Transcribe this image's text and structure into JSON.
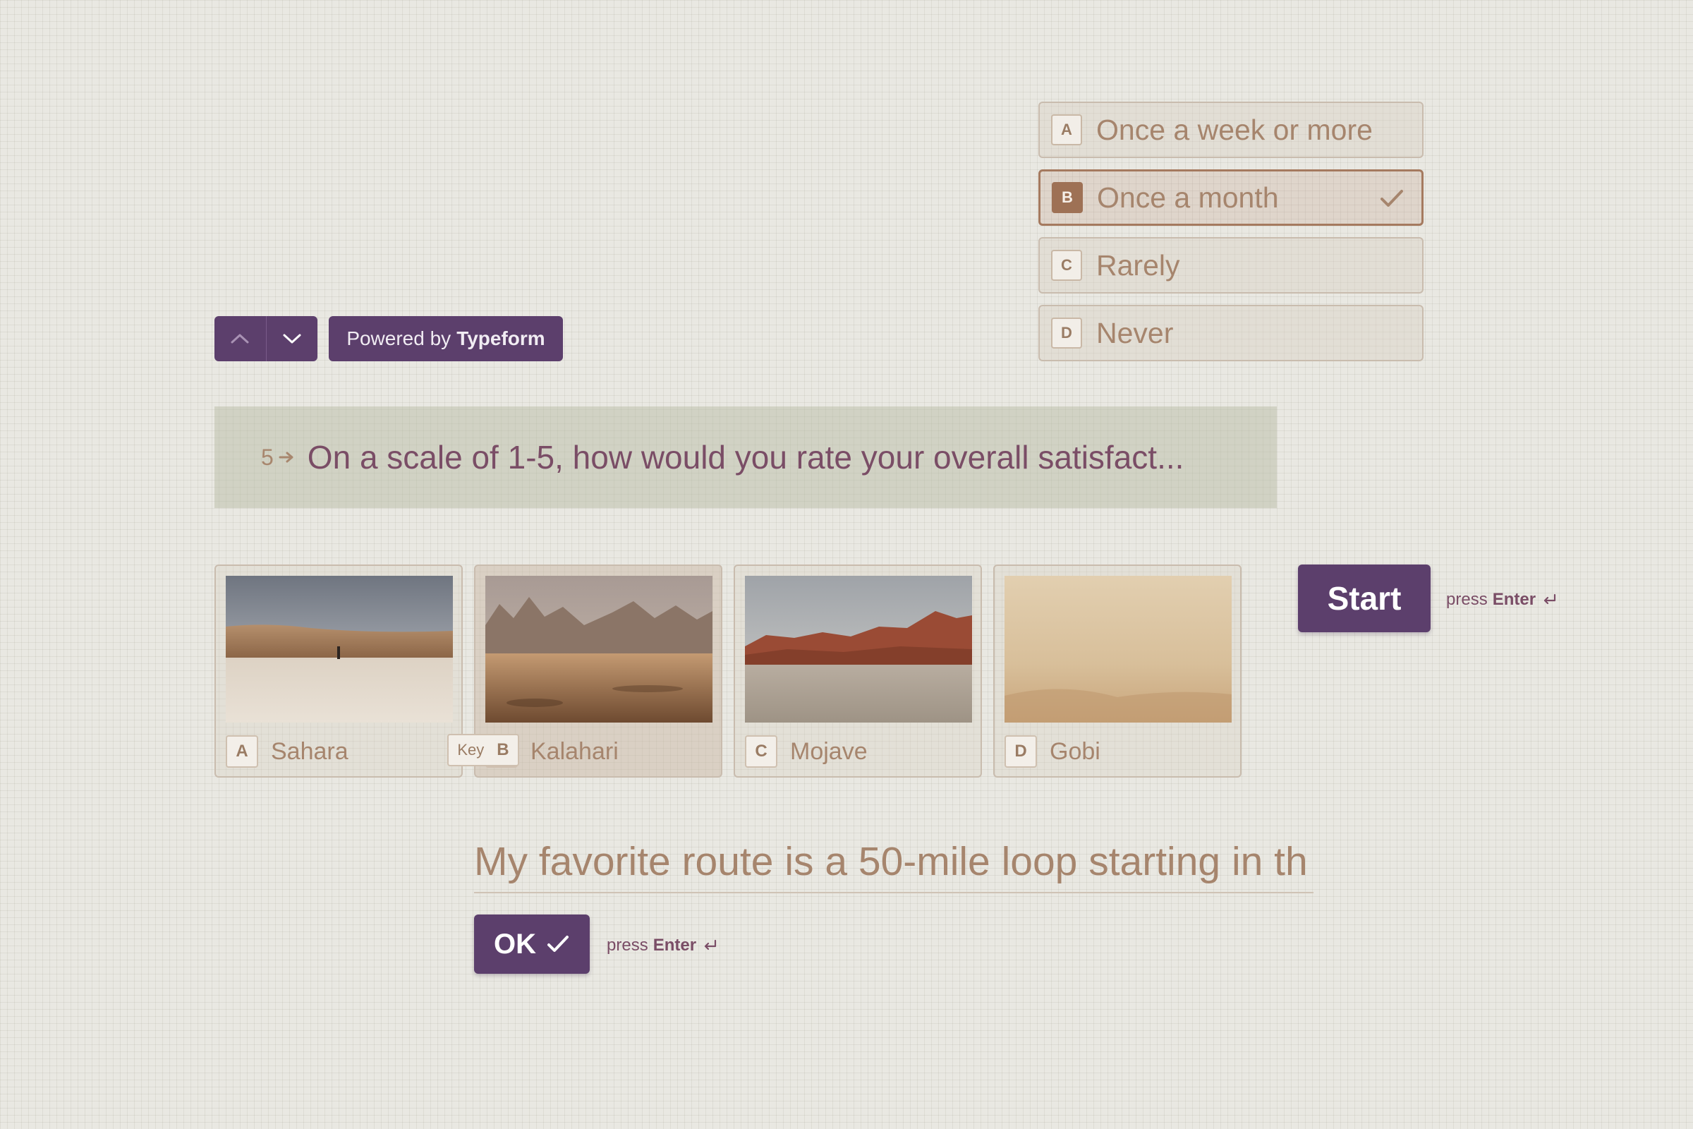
{
  "choices": [
    {
      "key": "A",
      "label": "Once a week or more",
      "selected": false
    },
    {
      "key": "B",
      "label": "Once a month",
      "selected": true
    },
    {
      "key": "C",
      "label": "Rarely",
      "selected": false
    },
    {
      "key": "D",
      "label": "Never",
      "selected": false
    }
  ],
  "nav": {
    "up_icon": "chevron-up-icon",
    "down_icon": "chevron-down-icon"
  },
  "powered": {
    "prefix": "Powered by",
    "brand": "Typeform"
  },
  "question": {
    "number": "5",
    "text": "On a scale of 1-5, how would you rate your overall satisfact..."
  },
  "cards": [
    {
      "key": "A",
      "label": "Sahara"
    },
    {
      "key": "B",
      "label": "Kalahari"
    },
    {
      "key": "C",
      "label": "Mojave"
    },
    {
      "key": "D",
      "label": "Gobi"
    }
  ],
  "key_tip": {
    "word": "Key",
    "letter": "B"
  },
  "start": {
    "label": "Start",
    "hint_prefix": "press",
    "hint_key": "Enter"
  },
  "answer": {
    "value": "My favorite route is a 50-mile loop starting in th"
  },
  "ok": {
    "label": "OK",
    "hint_prefix": "press",
    "hint_key": "Enter"
  },
  "colors": {
    "brand_purple": "#5c3f6c",
    "accent_brown": "#a6856d",
    "question_text": "#7a4d66"
  }
}
